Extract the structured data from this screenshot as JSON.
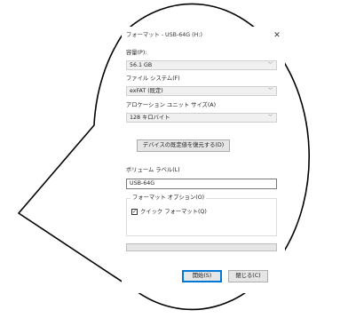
{
  "window": {
    "title": "フォーマット - USB-64G (H:)",
    "close_glyph": "✕"
  },
  "capacity": {
    "label": "容量(P):",
    "value": "56.1 GB"
  },
  "filesystem": {
    "label": "ファイル システム(F)",
    "value": "exFAT (既定)"
  },
  "allocation": {
    "label": "アロケーション ユニット サイズ(A)",
    "value": "128 キロバイト"
  },
  "restore_defaults_label": "デバイスの既定値を復元する(D)",
  "volume": {
    "label": "ボリューム ラベル(L)",
    "value": "USB-64G"
  },
  "format_options": {
    "title": "フォーマット オプション(O)",
    "quick_format_label": "クイック フォーマット(Q)",
    "quick_format_checked": true
  },
  "progress": {
    "value": 0
  },
  "buttons": {
    "start_label": "開始(S)",
    "close_label": "閉じる(C)"
  },
  "colors": {
    "accent": "#0078d7",
    "outline": "#000000"
  }
}
